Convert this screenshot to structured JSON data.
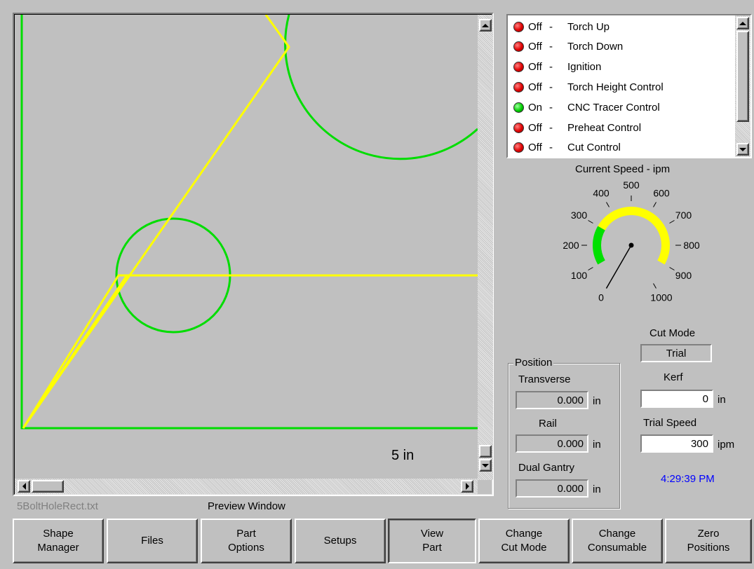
{
  "preview": {
    "scale_label": "5 in",
    "file_name": "5BoltHoleRect.txt",
    "window_label": "Preview Window",
    "colors": {
      "part": "#00dd00",
      "path": "#ffff00",
      "background": "#c0c0c0"
    }
  },
  "status_list": [
    {
      "state": "Off",
      "label": "Torch Up",
      "led": "red"
    },
    {
      "state": "Off",
      "label": "Torch Down",
      "led": "red"
    },
    {
      "state": "Off",
      "label": "Ignition",
      "led": "red"
    },
    {
      "state": "Off",
      "label": "Torch Height Control",
      "led": "red"
    },
    {
      "state": "On",
      "label": "CNC Tracer Control",
      "led": "green"
    },
    {
      "state": "Off",
      "label": "Preheat Control",
      "led": "red"
    },
    {
      "state": "Off",
      "label": "Cut Control",
      "led": "red"
    }
  ],
  "gauge": {
    "title": "Current Speed - ipm",
    "min": 0,
    "max": 1000,
    "value": 0,
    "ticks": [
      "0",
      "100",
      "200",
      "300",
      "400",
      "500",
      "600",
      "700",
      "800",
      "900",
      "1000"
    ],
    "green_end": 300,
    "colors": {
      "low": "#00e000",
      "high": "#ffff00"
    }
  },
  "position": {
    "group_label": "Position",
    "transverse_label": "Transverse",
    "transverse_value": "0.000",
    "rail_label": "Rail",
    "rail_value": "0.000",
    "dual_gantry_label": "Dual Gantry",
    "dual_gantry_value": "0.000",
    "unit": "in"
  },
  "cut_settings": {
    "cut_mode_label": "Cut Mode",
    "cut_mode_value": "Trial",
    "kerf_label": "Kerf",
    "kerf_value": "0",
    "kerf_unit": "in",
    "trial_speed_label": "Trial Speed",
    "trial_speed_value": "300",
    "trial_speed_unit": "ipm"
  },
  "clock": {
    "time": "4:29:39 PM",
    "color": "#0000ff"
  },
  "buttons": {
    "shape_manager": "Shape\nManager",
    "files": "Files",
    "part_options": "Part\nOptions",
    "setups": "Setups",
    "view_part": "View\nPart",
    "change_cut_mode": "Change\nCut Mode",
    "change_consumable": "Change\nConsumable",
    "zero_positions": "Zero\nPositions"
  }
}
